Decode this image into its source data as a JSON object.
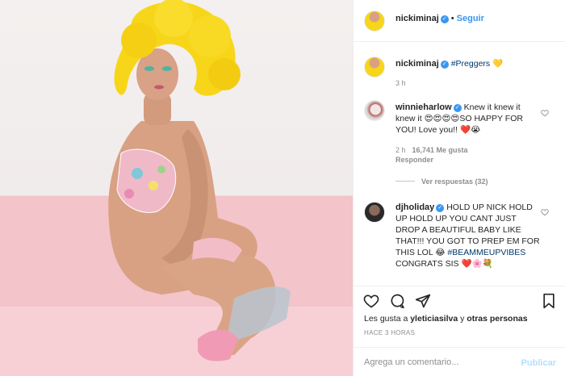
{
  "post": {
    "username": "nickiminaj",
    "follow_label": "Seguir",
    "dot": "•",
    "caption_hashtag": "#Preggers",
    "caption_emoji": "💛",
    "caption_time": "3 h"
  },
  "comments": [
    {
      "username": "winnieharlow",
      "text": "Knew it knew it knew it 😍😍😍😍SO HAPPY FOR YOU! Love you!! ❤️😭",
      "time": "2 h",
      "likes": "16,741 Me gusta",
      "reply": "Responder",
      "view_replies": "Ver respuestas (32)"
    },
    {
      "username": "djholiday",
      "text": "HOLD UP NICK HOLD UP HOLD UP YOU CANT JUST DROP A BEAUTIFUL BABY LIKE THAT!!! YOU GOT TO PREP EM FOR THIS LOL 😂",
      "hashtag": "#BEAMMEUPVIBES",
      "text_after": "CONGRATS SIS ❤️🌸💐"
    }
  ],
  "likes": {
    "prefix": "Les gusta a",
    "user": "yleticiasilva",
    "joiner": "y",
    "others": "otras personas"
  },
  "timestamp": "HACE 3 HORAS",
  "composer": {
    "placeholder": "Agrega un comentario...",
    "publish_label": "Publicar"
  },
  "colors": {
    "link_blue": "#3897f0",
    "hashtag": "#00376b",
    "muted": "#8e8e8e",
    "hair_yellow": "#f7d61a",
    "background_pink": "#f0b8bf"
  },
  "icons": [
    "heart-icon",
    "comment-icon",
    "share-icon",
    "bookmark-icon",
    "verified-icon"
  ]
}
